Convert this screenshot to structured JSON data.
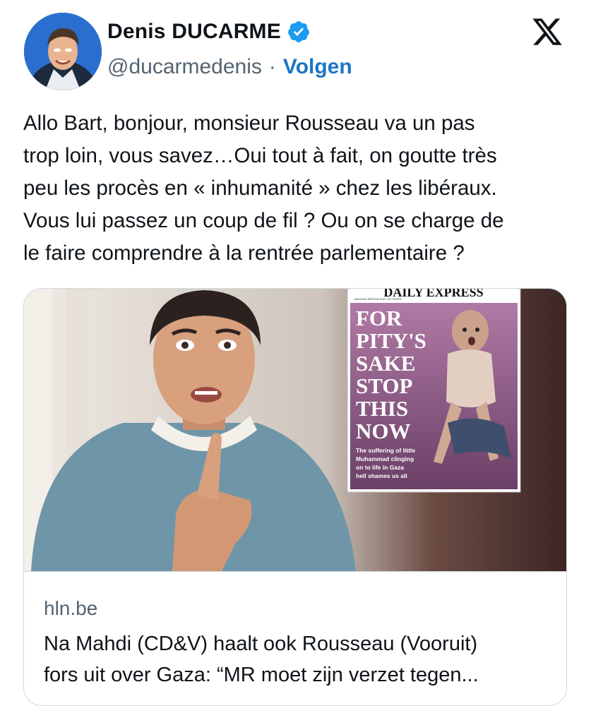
{
  "author": {
    "display_name": "Denis DUCARME",
    "handle": "@ducarmedenis",
    "separator": "·",
    "follow_label": "Volgen",
    "verified": true
  },
  "brand": {
    "logo_icon": "x-logo-icon"
  },
  "tweet": {
    "lines": [
      "Allo Bart, bonjour, monsieur Rousseau va un pas",
      "trop loin, vous savez…Oui tout à fait, on goutte très",
      "peu les procès en « inhumanité » chez les libéraux.",
      "Vous lui passez un coup de fil ? Ou on se charge de",
      "le faire comprendre à la rentrée parlementaire ?"
    ]
  },
  "link_card": {
    "domain": "hln.be",
    "headline_lines": [
      "Na Mahdi (CD&V) haalt ook Rousseau (Vooruit)",
      "fors uit over Gaza: “MR moet zijn verzet tegen..."
    ],
    "image": {
      "newspaper_masthead": "DAILY EXPRESS",
      "newspaper_tagline": "BACKING BRITAIN FOR 125 YEARS",
      "headline_lines": [
        "FOR",
        "PITY'S",
        "SAKE",
        "STOP",
        "THIS",
        "NOW"
      ],
      "subtext_lines": [
        "The suffering of little",
        "Muhammad clinging",
        "on to life in Gaza",
        "hell shames us all"
      ]
    }
  },
  "colors": {
    "accent_blue": "#1d74c4",
    "verified_blue": "#1d9bf0",
    "secondary_text": "#536471",
    "border": "#cfd9de"
  }
}
